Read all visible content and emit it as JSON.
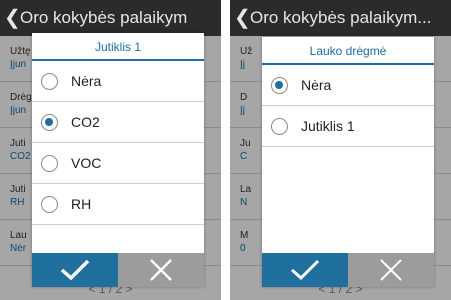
{
  "left": {
    "header_title": "Oro kokybės palaikym",
    "bg_rows": [
      {
        "l1": "Užtę",
        "l2": "Įjun"
      },
      {
        "l1": "Drėg",
        "l2": "Įjun"
      },
      {
        "l1": "Juti",
        "l2": "CO2"
      },
      {
        "l1": "Juti",
        "l2": "RH"
      },
      {
        "l1": "Lau",
        "l2": "Nėr"
      }
    ],
    "pager": "< 1 / 2 >",
    "dialog": {
      "title": "Jutiklis 1",
      "options": [
        {
          "label": "Nėra",
          "selected": false
        },
        {
          "label": "CO2",
          "selected": true
        },
        {
          "label": "VOC",
          "selected": false
        },
        {
          "label": "RH",
          "selected": false
        }
      ]
    }
  },
  "right": {
    "header_title": "Oro kokybės palaikym...",
    "bg_rows": [
      {
        "l1": "Už",
        "l2": "Įj"
      },
      {
        "l1": "D",
        "l2": "Įj"
      },
      {
        "l1": "Ju",
        "l2": "C"
      },
      {
        "l1": "La",
        "l2": "N"
      },
      {
        "l1": "M",
        "l2": "0"
      }
    ],
    "pager": "< 1 / 2 >",
    "dialog": {
      "title": "Lauko drėgmė",
      "options": [
        {
          "label": "Nėra",
          "selected": true
        },
        {
          "label": "Jutiklis 1",
          "selected": false
        }
      ]
    }
  },
  "colors": {
    "accent": "#1c6ea4",
    "ok_button": "#1f6f9f",
    "cancel_button": "#9c9c9c",
    "header_bg": "#2b2b2b"
  },
  "icons": {
    "back": "chevron-left-icon",
    "ok": "checkmark-icon",
    "cancel": "close-icon"
  }
}
